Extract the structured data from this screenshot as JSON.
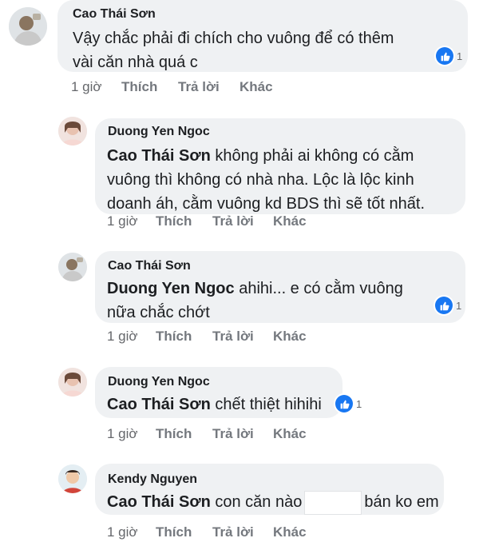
{
  "comments": [
    {
      "author": "Cao Thái Sơn",
      "lines": [
        "Vậy chắc phải đi chích cho vuông để có thêm",
        "vài căn nhà quá c"
      ],
      "reaction_count": "1",
      "time": "1 giờ",
      "like": "Thích",
      "reply": "Trả lời",
      "more": "Khác"
    },
    {
      "author": "Duong Yen Ngoc",
      "mention": "Cao Thái Sơn",
      "lines": [
        " không phải ai không có cằm",
        "vuông thì không có nhà nha. Lộc là lộc kinh",
        "doanh áh, cằm vuông kd BDS thì sẽ tốt nhất."
      ],
      "time": "1 giờ",
      "like": "Thích",
      "reply": "Trả lời",
      "more": "Khác"
    },
    {
      "author": "Cao Thái Sơn",
      "mention": "Duong Yen Ngoc",
      "lines": [
        " ahihi... e có cằm vuông",
        "nữa chắc chớt"
      ],
      "reaction_count": "1",
      "time": "1 giờ",
      "like": "Thích",
      "reply": "Trả lời",
      "more": "Khác"
    },
    {
      "author": "Duong Yen Ngoc",
      "mention": "Cao Thái Sơn",
      "lines": [
        " chết thiệt hihihi"
      ],
      "reaction_count": "1",
      "time": "1 giờ",
      "like": "Thích",
      "reply": "Trả lời",
      "more": "Khác"
    },
    {
      "author": "Kendy Nguyen",
      "mention": "Cao Thái Sơn",
      "lines": [
        " con căn nào",
        "bán ko em"
      ],
      "time": "1 giờ",
      "like": "Thích",
      "reply": "Trả lời",
      "more": "Khác"
    }
  ],
  "colors": {
    "bubble": "#eff1f3",
    "like_blue": "#1877f2",
    "meta": "#65676b"
  },
  "icons": {
    "reaction": "like-thumb-icon",
    "avatar": "profile-photo"
  }
}
